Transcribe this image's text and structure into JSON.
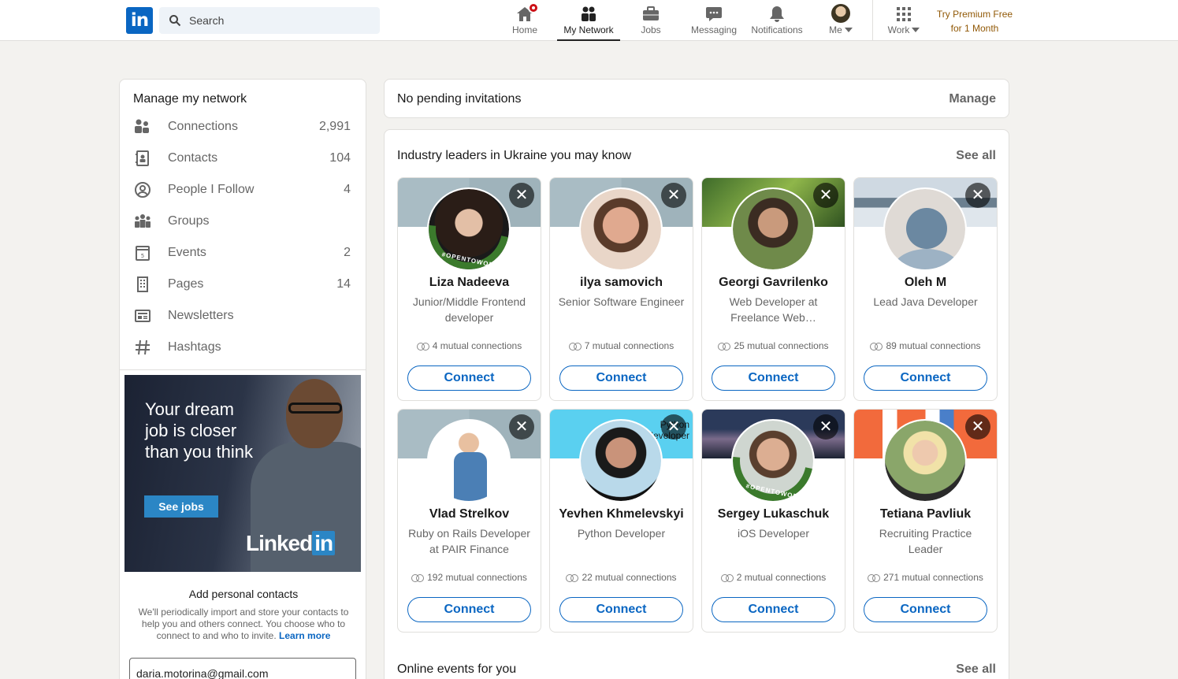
{
  "nav": {
    "search_placeholder": "Search",
    "items": [
      {
        "label": "Home"
      },
      {
        "label": "My Network"
      },
      {
        "label": "Jobs"
      },
      {
        "label": "Messaging"
      },
      {
        "label": "Notifications"
      },
      {
        "label": "Me"
      },
      {
        "label": "Work"
      }
    ],
    "premium_line1": "Try Premium Free",
    "premium_line2": "for 1 Month"
  },
  "sidebar": {
    "title": "Manage my network",
    "items": [
      {
        "label": "Connections",
        "count": "2,991",
        "icon": "people-icon"
      },
      {
        "label": "Contacts",
        "count": "104",
        "icon": "contact-book-icon"
      },
      {
        "label": "People I Follow",
        "count": "4",
        "icon": "follow-icon"
      },
      {
        "label": "Groups",
        "count": "",
        "icon": "groups-icon"
      },
      {
        "label": "Events",
        "count": "2",
        "icon": "calendar-icon"
      },
      {
        "label": "Pages",
        "count": "14",
        "icon": "building-icon"
      },
      {
        "label": "Newsletters",
        "count": "",
        "icon": "newsletter-icon"
      },
      {
        "label": "Hashtags",
        "count": "",
        "icon": "hashtag-icon"
      }
    ],
    "ad": {
      "text": "Your dream job is closer than you think",
      "button": "See jobs",
      "brand_left": "Linked",
      "brand_right": "in"
    },
    "contacts": {
      "heading": "Add personal contacts",
      "body": "We'll periodically import and store your contacts to help you and others connect. You choose who to connect to and who to invite.",
      "link": "Learn more",
      "email_value": "daria.motorina@gmail.com"
    }
  },
  "invitations": {
    "text": "No pending invitations",
    "manage": "Manage"
  },
  "suggestions": {
    "title": "Industry leaders in Ukraine you may know",
    "see_all": "See all",
    "connect_label": "Connect",
    "people": [
      {
        "name": "Liza Nadeeva",
        "title": "Junior/Middle Frontend developer",
        "mutual": "4 mutual connections",
        "open_to_work": true
      },
      {
        "name": "ilya samovich",
        "title": "Senior Software Engineer",
        "mutual": "7 mutual connections",
        "open_to_work": false
      },
      {
        "name": "Georgi Gavrilenko",
        "title": "Web Developer at Freelance Web…",
        "mutual": "25 mutual connections",
        "open_to_work": false
      },
      {
        "name": "Oleh M",
        "title": "Lead Java Developer",
        "mutual": "89 mutual connections",
        "open_to_work": false
      },
      {
        "name": "Vlad Strelkov",
        "title": "Ruby on Rails Developer at PAIR Finance",
        "mutual": "192 mutual connections",
        "open_to_work": false
      },
      {
        "name": "Yevhen Khmelevskyi",
        "title": "Python Developer",
        "mutual": "22 mutual connections",
        "open_to_work": false
      },
      {
        "name": "Sergey Lukaschuk",
        "title": "iOS Developer",
        "mutual": "2 mutual connections",
        "open_to_work": true
      },
      {
        "name": "Tetiana Pavliuk",
        "title": "Recruiting Practice Leader",
        "mutual": "271 mutual connections",
        "open_to_work": false
      }
    ]
  },
  "events": {
    "title": "Online events for you",
    "see_all": "See all"
  },
  "otw_badge": "#OPENTOWORK",
  "cover_text": "Python developer",
  "colors": {
    "accent": "#0a66c2",
    "premium": "#915907",
    "badge": "#cc1016",
    "open_to_work": "#3b7a2c"
  }
}
